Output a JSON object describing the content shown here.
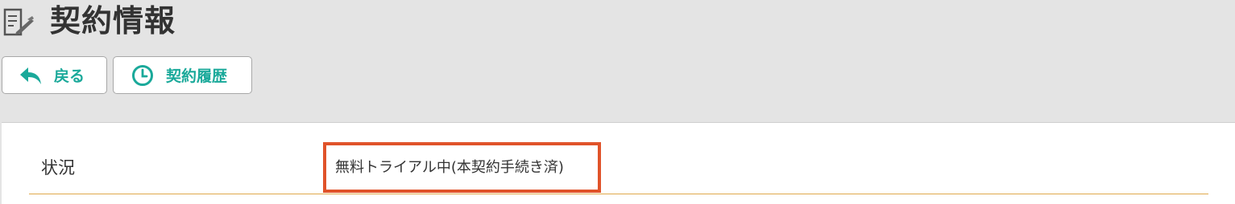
{
  "header": {
    "title": "契約情報",
    "title_icon": "document-pen-icon"
  },
  "toolbar": {
    "back_label": "戻る",
    "back_icon": "reply-arrow-icon",
    "history_label": "契約履歴",
    "history_icon": "clock-icon"
  },
  "contract": {
    "status_label": "状況",
    "status_value": "無料トライアル中(本契約手続き済)"
  },
  "colors": {
    "accent": "#1aa99a",
    "highlight": "#e0532a",
    "divider": "#e0a84a"
  }
}
